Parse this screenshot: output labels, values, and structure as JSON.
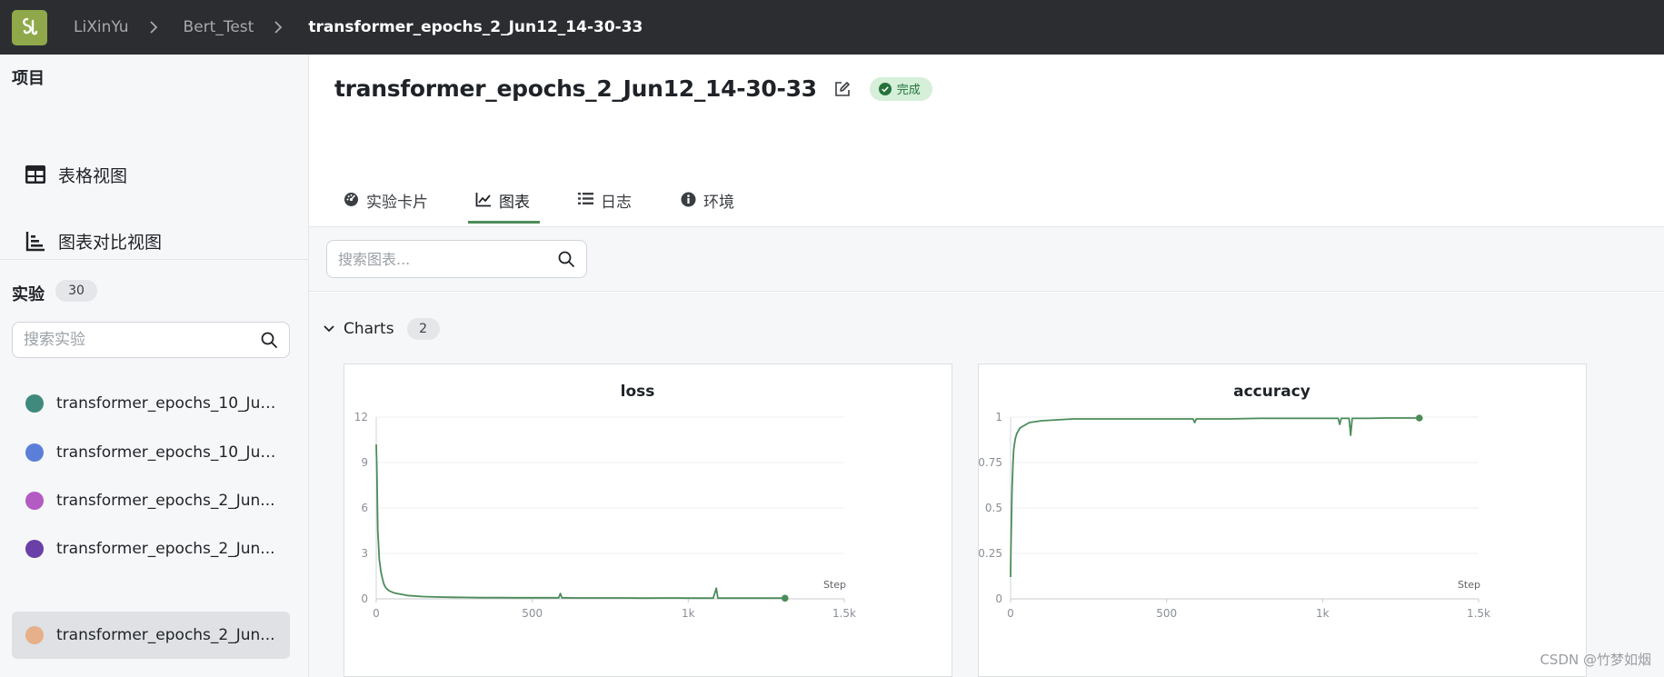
{
  "breadcrumb": {
    "items": [
      "LiXinYu",
      "Bert_Test",
      "transformer_epochs_2_Jun12_14-30-33"
    ]
  },
  "sidebar": {
    "project_heading": "项目",
    "nav": [
      {
        "label": "表格视图",
        "icon": "table-icon"
      },
      {
        "label": "图表对比视图",
        "icon": "chart-compare-icon"
      }
    ],
    "experiments_heading": "实验",
    "experiments_count": "30",
    "search_placeholder": "搜索实验",
    "experiments": [
      {
        "name": "transformer_epochs_10_Jun...",
        "color": "#3f8a7c"
      },
      {
        "name": "transformer_epochs_10_Jun...",
        "color": "#5b7fd9"
      },
      {
        "name": "transformer_epochs_2_Jun...",
        "color": "#b35ac3"
      },
      {
        "name": "transformer_epochs_2_Jun...",
        "color": "#6a3fa8"
      },
      {
        "name": "transformer_epochs_2_Jun...",
        "color": "#e5b08a",
        "selected": true
      }
    ]
  },
  "header": {
    "title": "transformer_epochs_2_Jun12_14-30-33",
    "status": "完成",
    "status_color": "#25733b"
  },
  "tabs": [
    {
      "label": "实验卡片",
      "icon": "dashboard-icon"
    },
    {
      "label": "图表",
      "icon": "line-chart-icon",
      "active": true
    },
    {
      "label": "日志",
      "icon": "list-icon"
    },
    {
      "label": "环境",
      "icon": "info-icon"
    }
  ],
  "toolbar": {
    "search_placeholder": "搜索图表..."
  },
  "charts_group": {
    "label": "Charts",
    "count": "2"
  },
  "colors": {
    "accent": "#4c8c5a",
    "series": "#4c8c5a"
  },
  "watermark": "CSDN @竹梦如烟",
  "chart_data": [
    {
      "type": "line",
      "title": "loss",
      "xlabel": "Step",
      "ylabel": "",
      "xlim": [
        0,
        1500
      ],
      "ylim": [
        0,
        12
      ],
      "x_ticks": [
        0,
        500,
        1000,
        1500
      ],
      "x_tick_labels": [
        "0",
        "500",
        "1k",
        "1.5k"
      ],
      "y_ticks": [
        0,
        3,
        6,
        9,
        12
      ],
      "y_tick_labels": [
        "0",
        "3",
        "6",
        "9",
        "12"
      ],
      "grid": true,
      "series": [
        {
          "x": [
            0,
            2,
            5,
            10,
            15,
            20,
            25,
            30,
            40,
            50,
            60,
            80,
            100,
            150,
            200,
            250,
            300,
            350,
            400,
            450,
            500,
            550,
            585,
            590,
            595,
            650,
            700,
            750,
            800,
            850,
            950,
            1000,
            1050,
            1080,
            1090,
            1095,
            1100,
            1150,
            1200,
            1250,
            1300,
            1310
          ],
          "y": [
            10.2,
            8.5,
            4.5,
            2.6,
            1.8,
            1.3,
            0.95,
            0.75,
            0.55,
            0.45,
            0.38,
            0.3,
            0.22,
            0.15,
            0.12,
            0.1,
            0.09,
            0.08,
            0.08,
            0.07,
            0.07,
            0.07,
            0.07,
            0.35,
            0.07,
            0.06,
            0.06,
            0.06,
            0.06,
            0.05,
            0.06,
            0.05,
            0.05,
            0.05,
            0.7,
            0.05,
            0.05,
            0.05,
            0.05,
            0.05,
            0.05,
            0.04
          ]
        }
      ]
    },
    {
      "type": "line",
      "title": "accuracy",
      "xlabel": "Step",
      "ylabel": "",
      "xlim": [
        0,
        1500
      ],
      "ylim": [
        0,
        1
      ],
      "x_ticks": [
        0,
        500,
        1000,
        1500
      ],
      "x_tick_labels": [
        "0",
        "500",
        "1k",
        "1.5k"
      ],
      "y_ticks": [
        0,
        0.25,
        0.5,
        0.75,
        1
      ],
      "y_tick_labels": [
        "0",
        "0.25",
        "0.5",
        "0.75",
        "1"
      ],
      "grid": true,
      "series": [
        {
          "x": [
            0,
            1,
            3,
            5,
            8,
            10,
            15,
            20,
            30,
            40,
            50,
            60,
            80,
            100,
            150,
            200,
            300,
            400,
            500,
            585,
            590,
            595,
            700,
            800,
            900,
            1000,
            1050,
            1055,
            1060,
            1085,
            1090,
            1095,
            1150,
            1200,
            1250,
            1300,
            1310
          ],
          "y": [
            0.12,
            0.25,
            0.45,
            0.62,
            0.75,
            0.82,
            0.88,
            0.91,
            0.94,
            0.95,
            0.96,
            0.97,
            0.975,
            0.98,
            0.985,
            0.99,
            0.99,
            0.99,
            0.99,
            0.99,
            0.97,
            0.99,
            0.99,
            0.993,
            0.993,
            0.993,
            0.993,
            0.96,
            0.993,
            0.993,
            0.9,
            0.993,
            0.993,
            0.995,
            0.995,
            0.995,
            0.995
          ]
        }
      ]
    }
  ]
}
